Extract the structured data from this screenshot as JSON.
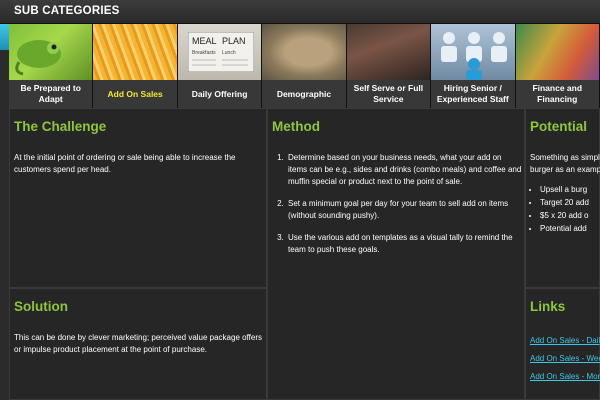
{
  "header": {
    "title": "SUB CATEGORIES"
  },
  "tabs": [
    {
      "label": "Be Prepared to Adapt",
      "active": false
    },
    {
      "label": "Add On Sales",
      "active": true
    },
    {
      "label": "Daily Offering",
      "active": false
    },
    {
      "label": "Demographic",
      "active": false
    },
    {
      "label": "Self Serve or Full Service",
      "active": false
    },
    {
      "label": "Hiring Senior / Experienced Staff",
      "active": false
    },
    {
      "label": "Finance and Financing",
      "active": false
    }
  ],
  "thumbnails": {
    "menu_board": [
      "MEAL",
      "PLAN",
      "Breakfasts",
      "Lunch"
    ]
  },
  "colors": {
    "accent_green": "#8dc63f",
    "active_tab_yellow": "#f3e830",
    "link_cyan": "#3ec8e6"
  },
  "challenge": {
    "title": "The Challenge",
    "text": "At the initial point of ordering or sale being able to increase the customers spend per head."
  },
  "solution": {
    "title": "Solution",
    "text": "This can be done by clever marketing; perceived value package offers or impulse product placement at the point of purchase."
  },
  "method": {
    "title": "Method",
    "steps": [
      "Determine based on your business needs, what your add on items can be e.g., sides and drinks (combo meals) and coffee and muffin special or product next to the point of sale.",
      "Set a minimum goal per day for your team to sell add on items (without sounding pushy).",
      "Use the various add on templates as a visual tally to remind the team to push these goals."
    ]
  },
  "potential": {
    "title": "Potential",
    "text_line1": "Something as simple",
    "text_line2": "burger as an example",
    "bullets": [
      "Upsell a burg",
      "Target 20 add",
      "$5 x 20 add o",
      "Potential add"
    ]
  },
  "links": {
    "title": "Links",
    "items": [
      "Add On Sales - Daily",
      "Add On Sales - Wee",
      "Add On Sales - Mon"
    ]
  }
}
